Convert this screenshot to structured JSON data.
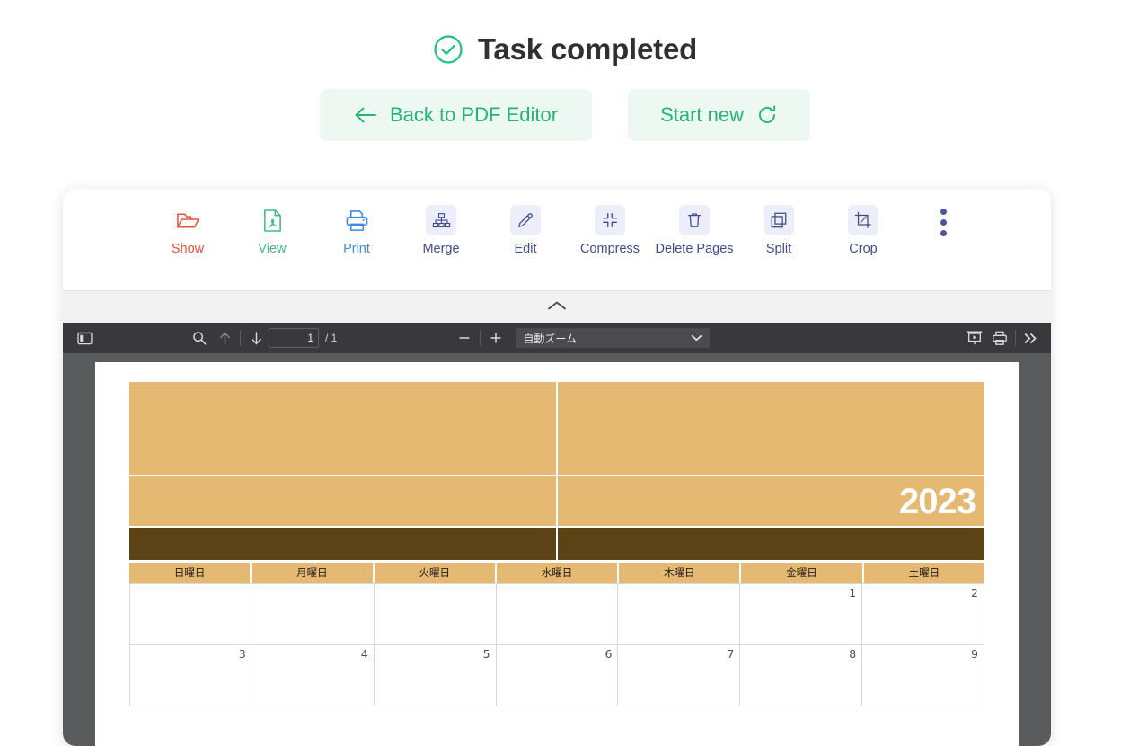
{
  "status": {
    "icon": "check-circle-icon",
    "title": "Task completed"
  },
  "actions": {
    "back_label": "Back to PDF Editor",
    "back_icon": "arrow-left-icon",
    "new_label": "Start new",
    "new_icon": "refresh-icon",
    "accent_color": "#22b573",
    "background_color": "#edf8f3"
  },
  "toolbar": {
    "tools": [
      {
        "label": "Show",
        "icon": "open-folder-icon",
        "color_class": "red",
        "chip": false
      },
      {
        "label": "View",
        "icon": "pdf-file-icon",
        "color_class": "green",
        "chip": false
      },
      {
        "label": "Print",
        "icon": "printer-icon",
        "color_class": "blue",
        "chip": false
      },
      {
        "label": "Merge",
        "icon": "merge-tree-icon",
        "color_class": "",
        "chip": true
      },
      {
        "label": "Edit",
        "icon": "pencil-icon",
        "color_class": "",
        "chip": true
      },
      {
        "label": "Compress",
        "icon": "compress-icon",
        "color_class": "",
        "chip": true
      },
      {
        "label": "Delete\nPages",
        "icon": "trash-icon",
        "color_class": "",
        "chip": true
      },
      {
        "label": "Split",
        "icon": "split-pages-icon",
        "color_class": "",
        "chip": true
      },
      {
        "label": "Crop",
        "icon": "crop-icon",
        "color_class": "",
        "chip": true
      }
    ],
    "more_icon": "more-vertical-icon",
    "collapse_icon": "chevron-up-icon"
  },
  "pdf_viewer": {
    "sidebar_toggle_icon": "sidebar-toggle-icon",
    "search_icon": "search-icon",
    "prev_icon": "arrow-up-icon",
    "next_icon": "arrow-down-icon",
    "page_number": "1",
    "page_total": "/ 1",
    "zoom_out_icon": "minus-icon",
    "zoom_in_icon": "plus-icon",
    "zoom_value": "自動ズーム",
    "zoom_caret_icon": "chevron-down-icon",
    "presentation_icon": "presentation-mode-icon",
    "print_icon": "printer-icon",
    "tools_icon": "double-chevron-right-icon"
  },
  "document": {
    "type": "calendar",
    "year": "2023",
    "day_headers": [
      "日曜日",
      "月曜日",
      "火曜日",
      "水曜日",
      "木曜日",
      "金曜日",
      "土曜日"
    ],
    "weeks": [
      [
        "",
        "",
        "",
        "",
        "",
        "1",
        "2"
      ],
      [
        "3",
        "4",
        "5",
        "6",
        "7",
        "8",
        "9"
      ]
    ],
    "colors": {
      "header_band": "#e5b971",
      "accent_band": "#5c4315",
      "year_text": "#ffffff"
    }
  }
}
